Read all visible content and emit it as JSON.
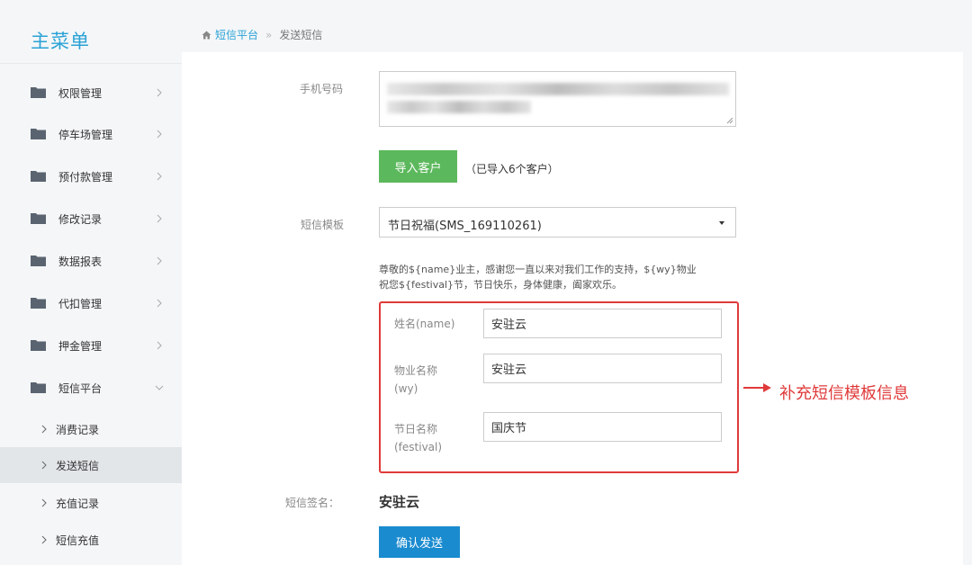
{
  "sidebar": {
    "title": "主菜单",
    "items": [
      {
        "label": "权限管理",
        "icon": "folder-icon"
      },
      {
        "label": "停车场管理",
        "icon": "folder-icon"
      },
      {
        "label": "预付款管理",
        "icon": "folder-icon"
      },
      {
        "label": "修改记录",
        "icon": "folder-icon"
      },
      {
        "label": "数据报表",
        "icon": "folder-icon"
      },
      {
        "label": "代扣管理",
        "icon": "folder-icon"
      },
      {
        "label": "押金管理",
        "icon": "folder-icon"
      },
      {
        "label": "短信平台",
        "icon": "folder-icon",
        "expanded": true
      }
    ],
    "subitems": [
      {
        "label": "消费记录"
      },
      {
        "label": "发送短信",
        "active": true
      },
      {
        "label": "充值记录"
      },
      {
        "label": "短信充值"
      }
    ]
  },
  "breadcrumb": {
    "home_label": "短信平台",
    "separator": "»",
    "current": "发送短信"
  },
  "form": {
    "phone_label": "手机号码",
    "import_button": "导入客户",
    "import_note": "（已导入6个客户）",
    "template_label": "短信模板",
    "template_selected": "节日祝福(SMS_169110261)",
    "template_text_line1": "尊敬的${name}业主，感谢您一直以来对我们工作的支持，${wy}物业",
    "template_text_line2": "祝您${festival}节，节日快乐，身体健康，阖家欢乐。",
    "fields": [
      {
        "label_line1": "姓名(name)",
        "label_line2": "",
        "value": "安驻云"
      },
      {
        "label_line1": "物业名称",
        "label_line2": "(wy)",
        "value": "安驻云"
      },
      {
        "label_line1": "节日名称",
        "label_line2": "(festival)",
        "value": "国庆节"
      }
    ],
    "signature_label": "短信签名：",
    "signature_value": "安驻云",
    "confirm_button": "确认发送"
  },
  "annotation": {
    "text": "补充短信模板信息",
    "color": "#e03a3a"
  },
  "colors": {
    "accent": "#2aa2d6",
    "import_button": "#5cb85c",
    "confirm_button": "#1a8bcf",
    "sidebar_bg": "#f4f6f8"
  }
}
